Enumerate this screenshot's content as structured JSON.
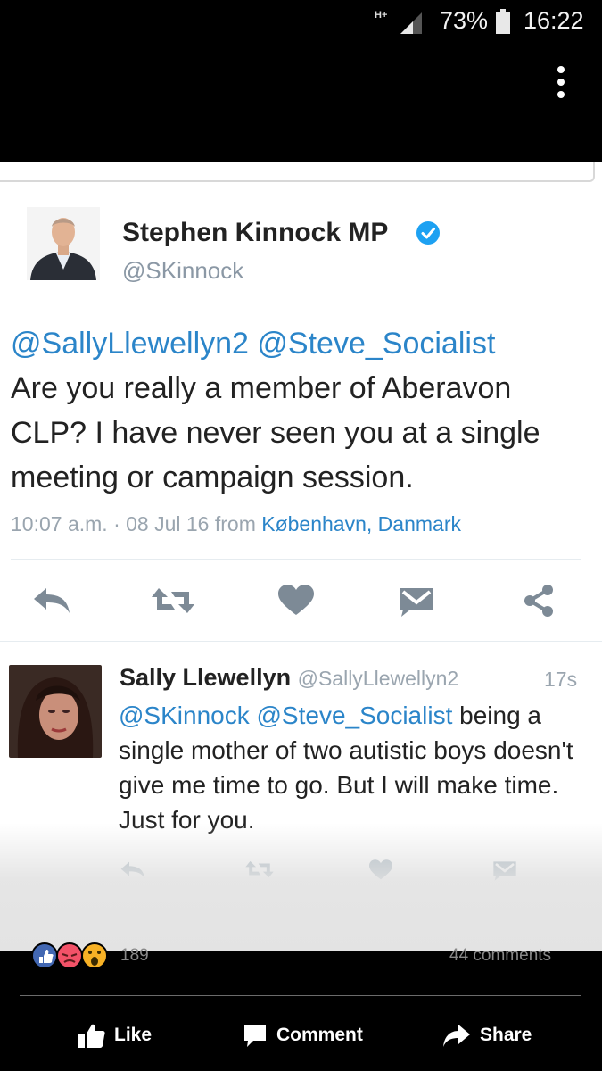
{
  "status_bar": {
    "network": "H+",
    "battery": "73%",
    "time": "16:22"
  },
  "tweet": {
    "author_name": "Stephen Kinnock MP",
    "author_handle": "@SKinnock",
    "mentions": "@SallyLlewellyn2 @Steve_Socialist",
    "body": "Are you really a member of Aberavon CLP? I have never seen you at a single meeting or campaign session.",
    "timestamp": "10:07 a.m. · 08 Jul 16 from",
    "location": "København, Danmark"
  },
  "reply": {
    "name": "Sally Llewellyn",
    "handle": "@SallyLlewellyn2",
    "age": "17s",
    "mentions": "@SKinnock @Steve_Socialist",
    "body": " being a single mother of two autistic boys doesn't give me time to go. But I will make time. Just for you."
  },
  "facebook": {
    "reaction_count": "189",
    "comments_count": "44 comments",
    "like_label": "Like",
    "comment_label": "Comment",
    "share_label": "Share"
  },
  "colors": {
    "twitter_blue": "#2b85c9",
    "icon_gray": "#aab8c2",
    "verified": "#1da1f2"
  }
}
